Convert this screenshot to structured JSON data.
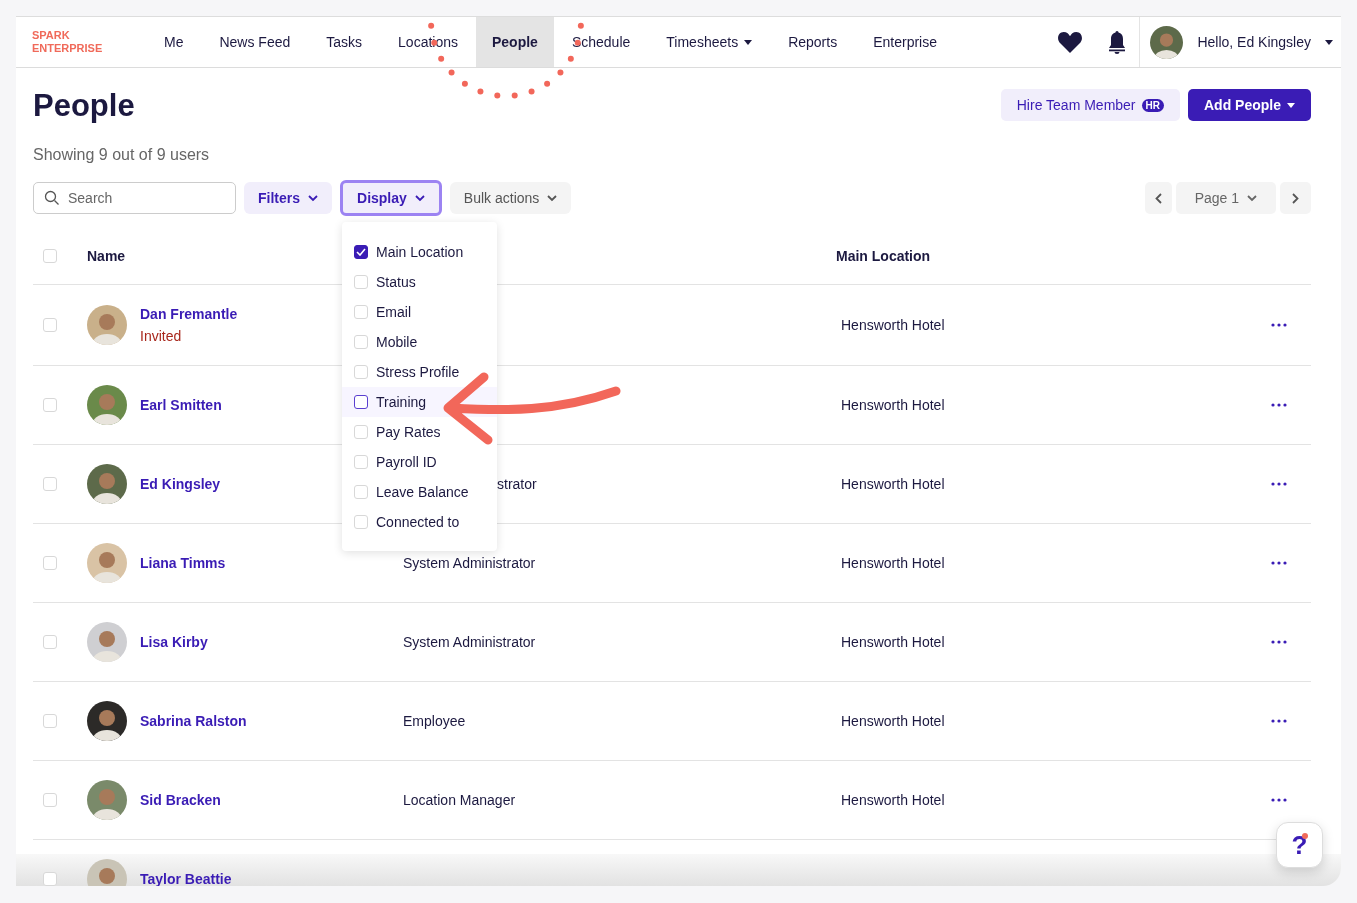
{
  "brand": {
    "line1": "SPARK",
    "line2": "ENTERPRISE"
  },
  "nav": [
    {
      "label": "Me",
      "selected": false,
      "caret": false
    },
    {
      "label": "News Feed",
      "selected": false,
      "caret": false
    },
    {
      "label": "Tasks",
      "selected": false,
      "caret": false
    },
    {
      "label": "Locations",
      "selected": false,
      "caret": false
    },
    {
      "label": "People",
      "selected": true,
      "caret": false
    },
    {
      "label": "Schedule",
      "selected": false,
      "caret": false
    },
    {
      "label": "Timesheets",
      "selected": false,
      "caret": true
    },
    {
      "label": "Reports",
      "selected": false,
      "caret": false
    },
    {
      "label": "Enterprise",
      "selected": false,
      "caret": false
    }
  ],
  "user": {
    "greeting": "Hello, Ed Kingsley"
  },
  "page": {
    "title": "People",
    "summary": "Showing 9 out of 9 users"
  },
  "actions": {
    "hire": {
      "label": "Hire Team Member",
      "badge": "HR"
    },
    "add": {
      "label": "Add People"
    }
  },
  "toolbar": {
    "search": {
      "placeholder": "Search"
    },
    "filters": "Filters",
    "display": {
      "label": "Display",
      "expanded": true
    },
    "bulk": "Bulk actions",
    "pager": {
      "label": "Page 1"
    }
  },
  "table": {
    "columns": {
      "name": "Name",
      "location": "Main Location"
    },
    "rows": [
      {
        "name": "Dan Fremantle",
        "status": "Invited",
        "location": "Hensworth Hotel",
        "checked": false
      },
      {
        "name": "Earl Smitten",
        "location": "Hensworth Hotel",
        "checked": false
      },
      {
        "name": "Ed Kingsley",
        "role": "strator",
        "location": "Hensworth Hotel",
        "checked": false,
        "role_covered": true
      },
      {
        "name": "Liana Timms",
        "role": "System Administrator",
        "location": "Hensworth Hotel",
        "checked": false
      },
      {
        "name": "Lisa Kirby",
        "role": "System Administrator",
        "location": "Hensworth Hotel",
        "checked": false
      },
      {
        "name": "Sabrina Ralston",
        "role": "Employee",
        "location": "Hensworth Hotel",
        "checked": false
      },
      {
        "name": "Sid Bracken",
        "role": "Location Manager",
        "location": "Hensworth Hotel",
        "checked": false
      },
      {
        "name": "Taylor Beattie",
        "checked": false
      }
    ],
    "select_all": {
      "checked": false
    }
  },
  "display_menu": [
    {
      "label": "Main Location",
      "checked": true,
      "focused": false
    },
    {
      "label": "Status",
      "checked": false,
      "focused": false
    },
    {
      "label": "Email",
      "checked": false,
      "focused": false
    },
    {
      "label": "Mobile",
      "checked": false,
      "focused": false
    },
    {
      "label": "Stress Profile",
      "checked": false,
      "focused": false
    },
    {
      "label": "Training",
      "checked": false,
      "focused": true
    },
    {
      "label": "Pay Rates",
      "checked": false,
      "focused": false
    },
    {
      "label": "Payroll ID",
      "checked": false,
      "focused": false
    },
    {
      "label": "Leave Balance",
      "checked": false,
      "focused": false
    },
    {
      "label": "Connected to",
      "checked": false,
      "focused": false
    }
  ],
  "help": {
    "label": "?",
    "unread": true
  }
}
